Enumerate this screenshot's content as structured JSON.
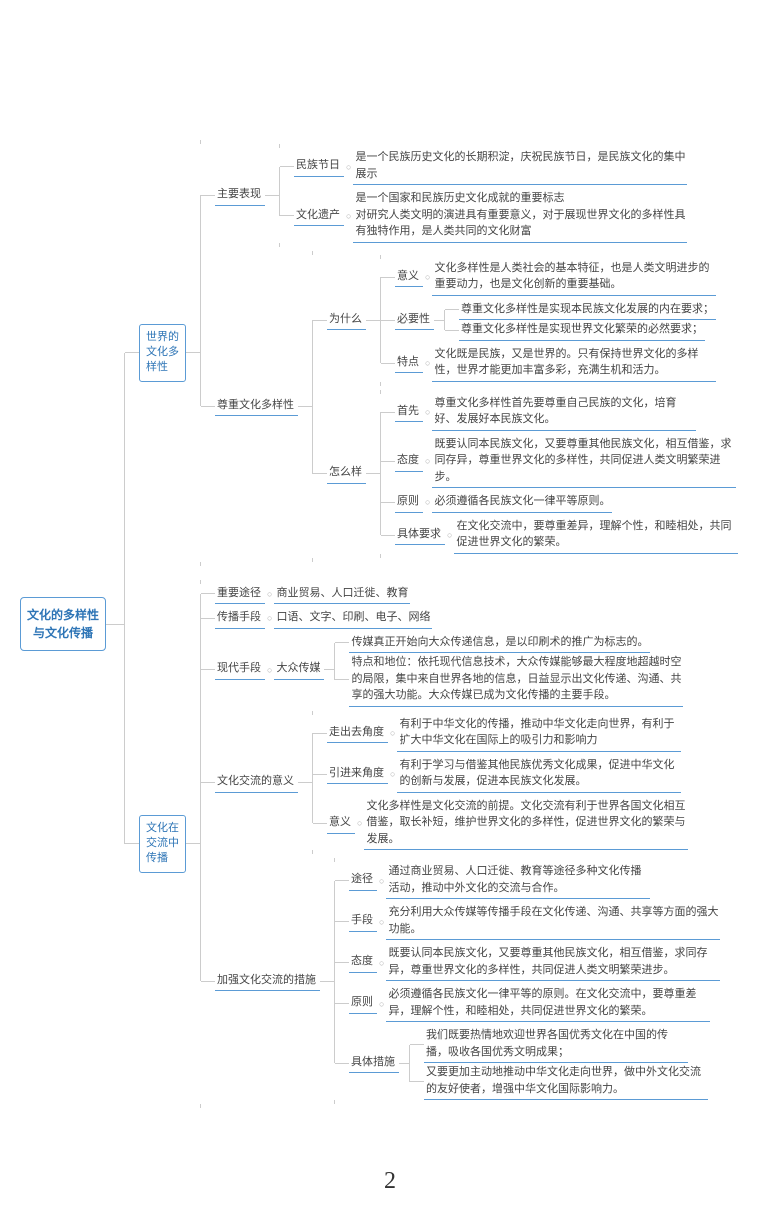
{
  "root": "文化的多样性\n与文化传播",
  "pageNum": "2",
  "b1": {
    "title": "世界的\n文化多\n样性",
    "a": {
      "label": "主要表现",
      "n1": {
        "label": "民族节日",
        "text": "是一个民族历史文化的长期积淀，庆祝民族节日，是民族文化的集中展示"
      },
      "n2": {
        "label": "文化遗产",
        "text": "是一个国家和民族历史文化成就的重要标志\n对研究人类文明的演进具有重要意义，对于展现世界文化的多样性具有独特作用，是人类共同的文化财富"
      }
    },
    "b": {
      "label": "尊重文化多样性",
      "why": {
        "label": "为什么",
        "yi": {
          "label": "意义",
          "text": "文化多样性是人类社会的基本特征，也是人类文明进步的重要动力，也是文化创新的重要基础。"
        },
        "bi": {
          "label": "必要性",
          "t1": "尊重文化多样性是实现本民族文化发展的内在要求；",
          "t2": "尊重文化多样性是实现世界文化繁荣的必然要求；"
        },
        "te": {
          "label": "特点",
          "text": "文化既是民族，又是世界的。只有保持世界文化的多样性，世界才能更加丰富多彩，充满生机和活力。"
        }
      },
      "how": {
        "label": "怎么样",
        "sx": {
          "label": "首先",
          "text": "尊重文化多样性首先要尊重自己民族的文化，培育好、发展好本民族文化。"
        },
        "td": {
          "label": "态度",
          "text": "既要认同本民族文化，又要尊重其他民族文化，相互借鉴，求同存异，尊重世界文化的多样性，共同促进人类文明繁荣进步。"
        },
        "yz": {
          "label": "原则",
          "text": "必须遵循各民族文化一律平等原则。"
        },
        "jt": {
          "label": "具体要求",
          "text": "在文化交流中，要尊重差异，理解个性，和睦相处，共同促进世界文化的繁荣。"
        }
      }
    }
  },
  "b2": {
    "title": "文化在\n交流中\n传播",
    "r1": {
      "label": "重要途径",
      "text": "商业贸易、人口迁徙、教育"
    },
    "r2": {
      "label": "传播手段",
      "text": "口语、文字、印刷、电子、网络"
    },
    "r3": {
      "label": "现代手段",
      "sub": "大众传媒",
      "t1": "传媒真正开始向大众传递信息，是以印刷术的推广为标志的。",
      "t2": "特点和地位：依托现代信息技术，大众传媒能够最大程度地超越时空的局限，集中来自世界各地的信息，日益显示出文化传递、沟通、共享的强大功能。大众传媒已成为文化传播的主要手段。"
    },
    "r4": {
      "label": "文化交流的意义",
      "o": {
        "label": "走出去角度",
        "text": "有利于中华文化的传播，推动中华文化走向世界，有利于扩大中华文化在国际上的吸引力和影响力"
      },
      "i": {
        "label": "引进来角度",
        "text": "有利于学习与借鉴其他民族优秀文化成果，促进中华文化的创新与发展，促进本民族文化发展。"
      },
      "m": {
        "label": "意义",
        "text": "文化多样性是文化交流的前提。文化交流有利于世界各国文化相互借鉴，取长补短，维护世界文化的多样性，促进世界文化的繁荣与发展。"
      }
    },
    "r5": {
      "label": "加强文化交流的措施",
      "tj": {
        "label": "途径",
        "text": "通过商业贸易、人口迁徙、教育等途径多种文化传播活动，推动中外文化的交流与合作。"
      },
      "sd": {
        "label": "手段",
        "text": "充分利用大众传媒等传播手段在文化传递、沟通、共享等方面的强大功能。"
      },
      "td": {
        "label": "态度",
        "text": "既要认同本民族文化，又要尊重其他民族文化，相互借鉴，求同存异，尊重世界文化的多样性，共同促进人类文明繁荣进步。"
      },
      "yz": {
        "label": "原则",
        "text": "必须遵循各民族文化一律平等的原则。在文化交流中，要尊重差异，理解个性，和睦相处，共同促进世界文化的繁荣。"
      },
      "jt": {
        "label": "具体措施",
        "t1": "我们既要热情地欢迎世界各国优秀文化在中国的传播，吸收各国优秀文明成果；",
        "t2": "又要更加主动地推动中华文化走向世界，做中外文化交流的友好使者，增强中华文化国际影响力。"
      }
    }
  }
}
